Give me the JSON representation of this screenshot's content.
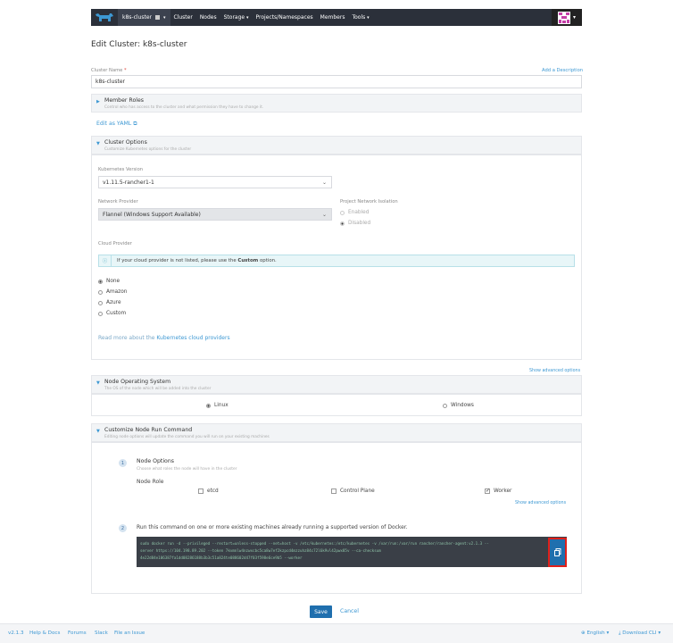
{
  "nav": {
    "cluster": "k8s-cluster",
    "items": [
      "Cluster",
      "Nodes",
      "Storage",
      "Projects/Namespaces",
      "Members",
      "Tools"
    ]
  },
  "page": {
    "title": "Edit Cluster: k8s-cluster",
    "cluster_name_label": "Cluster Name",
    "required_mark": "*",
    "add_description": "Add a Description",
    "cluster_name_value": "k8s-cluster",
    "edit_yaml": "Edit as YAML"
  },
  "member_roles": {
    "title": "Member Roles",
    "subtitle": "Control who has access to the cluster and what permission they have to change it."
  },
  "cluster_options": {
    "title": "Cluster Options",
    "subtitle": "Customize Kubernetes options for the cluster",
    "k8s_version_label": "Kubernetes Version",
    "k8s_version_value": "v1.11.5-rancher1-1",
    "network_provider_label": "Network Provider",
    "network_provider_value": "Flannel (Windows Support Available)",
    "isolation_label": "Project Network Isolation",
    "isolation_enabled": "Enabled",
    "isolation_disabled": "Disabled",
    "cloud_provider_label": "Cloud Provider",
    "info_prefix": "If your cloud provider is not listed, please use the",
    "info_bold": "Custom",
    "info_suffix": "option.",
    "providers": [
      "None",
      "Amazon",
      "Azure",
      "Custom"
    ],
    "read_more_prefix": "Read more about the",
    "read_more_link": "Kubernetes cloud providers",
    "show_advanced": "Show advanced options"
  },
  "node_os": {
    "title": "Node Operating System",
    "subtitle": "The OS of the node which will be added into the cluster",
    "linux": "Linux",
    "windows": "Windows"
  },
  "node_cmd": {
    "title": "Customize Node Run Command",
    "subtitle": "Editing node options will update the command you will run on your existing machines",
    "step1": "1",
    "step2": "2",
    "node_options_title": "Node Options",
    "node_options_subtitle": "Choose what roles the node will have in the cluster",
    "node_role_label": "Node Role",
    "roles": [
      "etcd",
      "Control Plane",
      "Worker"
    ],
    "show_advanced": "Show advanced options",
    "run_text": "Run this command on one or more existing machines already running a supported version of Docker.",
    "command_lines": [
      "sudo docker run -d --privileged --restart=unless-stopped --net=host -v /etc/kubernetes:/etc/kubernetes -v /var/run:/var/run rancher/rancher-agent:v2.1.3 --",
      "server https://104.198.89.202 --token 7kvmnlw4nzwxcbc5ca8w7ef2kzpcd4mzzuhz84c72l6k9vl42pwx85v --ca-checksum",
      "4e22d84e106387fa1dd08286188b3b3c51a824te088602d47f03f598e6ce9b5 --worker"
    ]
  },
  "actions": {
    "save": "Save",
    "cancel": "Cancel"
  },
  "footer": {
    "version": "v2.1.3",
    "help": "Help & Docs",
    "forums": "Forums",
    "slack": "Slack",
    "issue": "File an Issue",
    "language": "English",
    "download": "Download CLI"
  }
}
